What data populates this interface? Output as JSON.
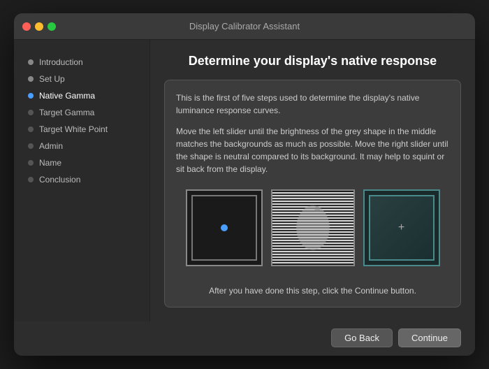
{
  "window": {
    "title": "Display Calibrator Assistant"
  },
  "main": {
    "heading": "Determine your display's native response",
    "description1": "This is the first of five steps used to determine the display's native luminance response curves.",
    "description2": "Move the left slider until the brightness of the grey shape in the middle matches the backgrounds as much as possible. Move the right slider until the shape is neutral compared to its background. It may help to squint or sit back from the display.",
    "bottom_instruction": "After you have done this step, click the Continue button."
  },
  "sidebar": {
    "items": [
      {
        "label": "Introduction",
        "state": "done"
      },
      {
        "label": "Set Up",
        "state": "done"
      },
      {
        "label": "Native Gamma",
        "state": "active"
      },
      {
        "label": "Target Gamma",
        "state": "inactive"
      },
      {
        "label": "Target White Point",
        "state": "inactive"
      },
      {
        "label": "Admin",
        "state": "inactive"
      },
      {
        "label": "Name",
        "state": "inactive"
      },
      {
        "label": "Conclusion",
        "state": "inactive"
      }
    ]
  },
  "footer": {
    "go_back": "Go Back",
    "continue": "Continue"
  }
}
